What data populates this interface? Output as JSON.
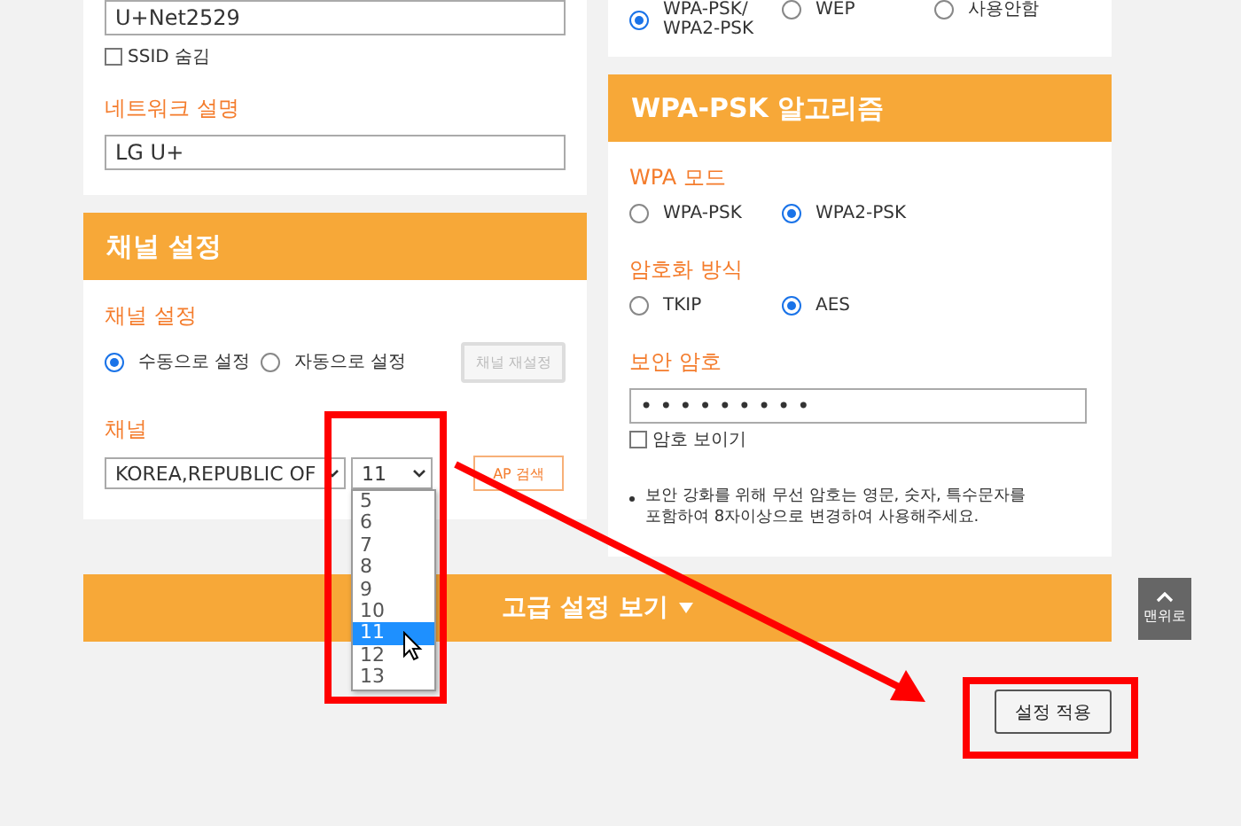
{
  "network_panel": {
    "ssid_value": "U+Net2529",
    "hide_ssid": {
      "label": "SSID 숨김",
      "checked": false
    },
    "description_label": "네트워크 설명",
    "description_value": "LG U+"
  },
  "channel_panel": {
    "title": "채널 설정",
    "mode_label": "채널 설정",
    "modes": [
      {
        "label": "수동으로 설정",
        "selected": true
      },
      {
        "label": "자동으로 설정",
        "selected": false
      }
    ],
    "reset_button": {
      "label": "채널 재설정",
      "disabled": true
    },
    "channel_label": "채널",
    "country": "KOREA,REPUBLIC OF",
    "channel": "11",
    "ap_button": "AP 검색",
    "dropdown": {
      "expanded": true,
      "options": [
        {
          "label": "5",
          "selected": false
        },
        {
          "label": "6",
          "selected": false
        },
        {
          "label": "7",
          "selected": false
        },
        {
          "label": "8",
          "selected": false
        },
        {
          "label": "9",
          "selected": false
        },
        {
          "label": "10",
          "selected": false
        },
        {
          "label": "11",
          "selected": true
        },
        {
          "label": "12",
          "selected": false
        },
        {
          "label": "13",
          "selected": false
        }
      ]
    }
  },
  "security_options": [
    {
      "label": "WPA-PSK/\nWPA2-PSK",
      "selected": true
    },
    {
      "label": "WEP",
      "selected": false
    },
    {
      "label": "사용안함",
      "selected": false
    }
  ],
  "algorithm_panel": {
    "title": "WPA-PSK 알고리즘",
    "mode_label": "WPA 모드",
    "modes": [
      {
        "label": "WPA-PSK",
        "selected": false
      },
      {
        "label": "WPA2-PSK",
        "selected": true
      }
    ],
    "encryption_label": "암호화 방식",
    "encryptions": [
      {
        "label": "TKIP",
        "selected": false
      },
      {
        "label": "AES",
        "selected": true
      }
    ],
    "password_label": "보안 암호",
    "password_value": "•••••••••",
    "show_password": {
      "label": "암호 보이기",
      "checked": false
    },
    "note": "보안 강화를 위해 무선 암호는 영문, 숫자, 특수문자를\n포함하여 8자이상으로 변경하여 사용해주세요."
  },
  "advanced_bar": {
    "label": "고급 설정 보기"
  },
  "top_button": "맨위로",
  "apply_button": "설정 적용"
}
